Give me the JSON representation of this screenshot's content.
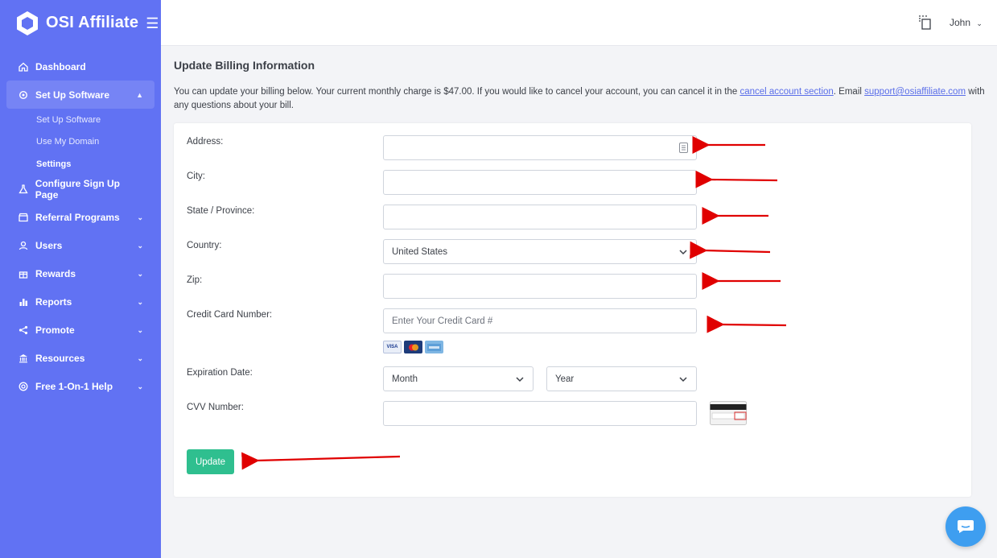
{
  "brand": {
    "name": "OSI Affiliate"
  },
  "sidebar": {
    "items": [
      {
        "label": "Dashboard",
        "icon": "home-icon"
      },
      {
        "label": "Set Up Software",
        "icon": "gear-icon",
        "active": true,
        "expanded": true,
        "children": [
          {
            "label": "Set Up Software"
          },
          {
            "label": "Use My Domain"
          },
          {
            "label": "Settings",
            "current": true
          }
        ]
      },
      {
        "label": "Configure Sign Up Page",
        "icon": "flask-icon"
      },
      {
        "label": "Referral Programs",
        "icon": "store-icon"
      },
      {
        "label": "Users",
        "icon": "user-icon"
      },
      {
        "label": "Rewards",
        "icon": "gift-icon"
      },
      {
        "label": "Reports",
        "icon": "bar-chart-icon"
      },
      {
        "label": "Promote",
        "icon": "share-icon"
      },
      {
        "label": "Resources",
        "icon": "bank-icon"
      },
      {
        "label": "Free 1-On-1 Help",
        "icon": "lifebuoy-icon"
      }
    ]
  },
  "topbar": {
    "user": "John"
  },
  "page": {
    "title": "Update Billing Information",
    "intro_before": "You can update your billing below. Your current monthly charge is $47.00. If you would like to cancel your account, you can cancel it in the ",
    "intro_link1": "cancel account section",
    "intro_middle": ". Email ",
    "intro_link2": "support@osiaffiliate.com",
    "intro_after": " with any questions about your bill."
  },
  "form": {
    "address_label": "Address:",
    "city_label": "City:",
    "state_label": "State / Province:",
    "country_label": "Country:",
    "country_value": "United States",
    "zip_label": "Zip:",
    "cc_label": "Credit Card Number:",
    "cc_placeholder": "Enter Your Credit Card #",
    "exp_label": "Expiration Date:",
    "month_value": "Month",
    "year_value": "Year",
    "cvv_label": "CVV Number:",
    "card_brands": [
      "VISA",
      "MC",
      "AMEX"
    ],
    "update_label": "Update"
  },
  "colors": {
    "sidebar": "#6172f3",
    "accent_green": "#2fbf8f",
    "link": "#5a6ee9",
    "annotation_arrow": "#e00000"
  }
}
